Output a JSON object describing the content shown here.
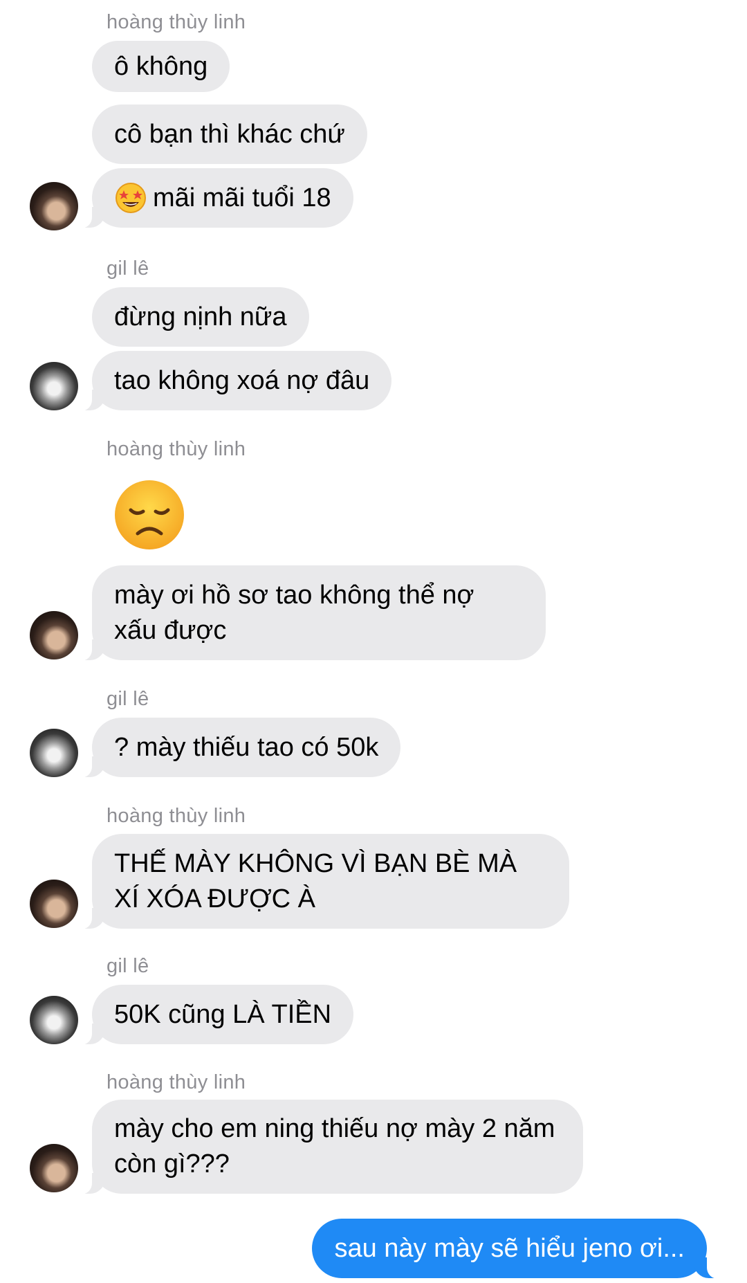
{
  "conversation": [
    {
      "type": "sender",
      "text": "hoàng thùy linh"
    },
    {
      "type": "message",
      "text": "ô không"
    },
    {
      "type": "message",
      "text": "cô bạn thì khác chứ"
    },
    {
      "type": "message",
      "text": "mãi mãi tuổi 18",
      "emoji": "star-struck-emoji"
    },
    {
      "type": "sender",
      "text": "gil lê"
    },
    {
      "type": "message",
      "text": "đừng nịnh nữa"
    },
    {
      "type": "message",
      "text": "tao không xoá nợ đâu"
    },
    {
      "type": "sender",
      "text": "hoàng thùy linh"
    },
    {
      "type": "emoji_message",
      "emoji": "disappointed-face-emoji"
    },
    {
      "type": "message",
      "text": "mày ơi hồ sơ tao không thể nợ xấu được"
    },
    {
      "type": "sender",
      "text": "gil lê"
    },
    {
      "type": "message",
      "text": "? mày thiếu tao có 50k"
    },
    {
      "type": "sender",
      "text": "hoàng thùy linh"
    },
    {
      "type": "message",
      "text": "THẾ MÀY KHÔNG VÌ BẠN BÈ MÀ XÍ XÓA ĐƯỢC À"
    },
    {
      "type": "sender",
      "text": "gil lê"
    },
    {
      "type": "message",
      "text": "50K cũng LÀ TIỀN"
    },
    {
      "type": "sender",
      "text": "hoàng thùy linh"
    },
    {
      "type": "message",
      "text": "mày cho em ning thiếu nợ mày 2 năm còn gì???"
    },
    {
      "type": "outgoing",
      "text": "sau này mày sẽ hiểu jeno ơi..."
    }
  ],
  "colors": {
    "incoming_bubble": "#e9e9eb",
    "outgoing_bubble": "#1f8af5",
    "sender_label": "#8e8e93"
  }
}
